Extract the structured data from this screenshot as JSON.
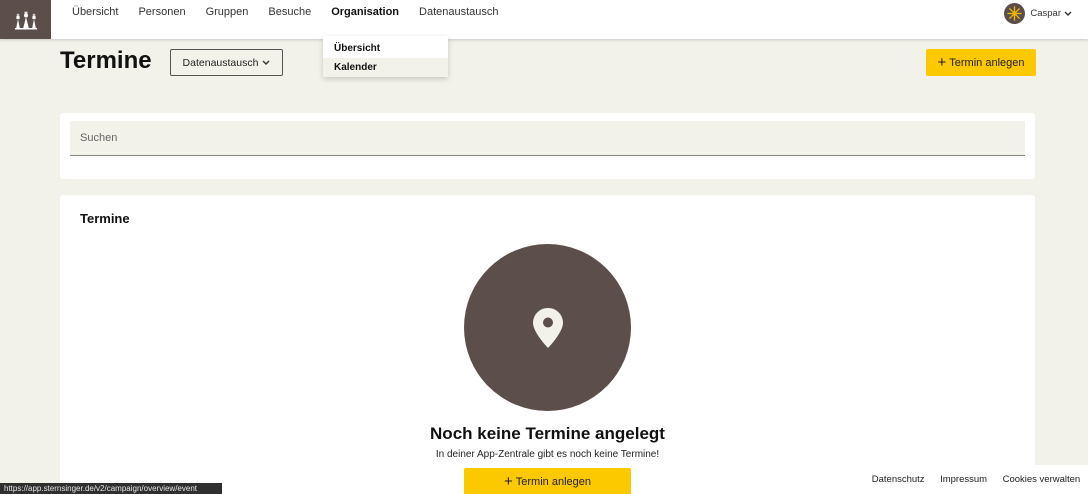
{
  "nav": {
    "items": [
      {
        "label": "Übersicht"
      },
      {
        "label": "Personen"
      },
      {
        "label": "Gruppen"
      },
      {
        "label": "Besuche"
      },
      {
        "label": "Organisation",
        "active": true
      },
      {
        "label": "Datenaustausch"
      }
    ]
  },
  "dropdown": {
    "items": [
      {
        "label": "Übersicht"
      },
      {
        "label": "Kalender"
      }
    ]
  },
  "user": {
    "name": "Caspar",
    "avatar_icon": "sun-star-icon"
  },
  "header": {
    "title": "Termine",
    "filter_label": "Datenaustausch",
    "add_button_label": "Termin anlegen"
  },
  "search": {
    "placeholder": "Suchen",
    "value": ""
  },
  "list": {
    "title": "Termine",
    "empty_icon": "map-pin-icon",
    "empty_title": "Noch keine Termine angelegt",
    "empty_text": "In deiner App-Zentrale gibt es noch keine Termine!",
    "add_button_label": "Termin anlegen"
  },
  "footer": {
    "links": [
      {
        "label": "Datenschutz"
      },
      {
        "label": "Impressum"
      },
      {
        "label": "Cookies verwalten"
      }
    ]
  },
  "status_url": "https://app.sternsinger.de/v2/campaign/overview/event",
  "colors": {
    "brand_brown": "#5c4f4b",
    "accent_yellow": "#fcc800",
    "page_bg": "#f3f2ea"
  }
}
